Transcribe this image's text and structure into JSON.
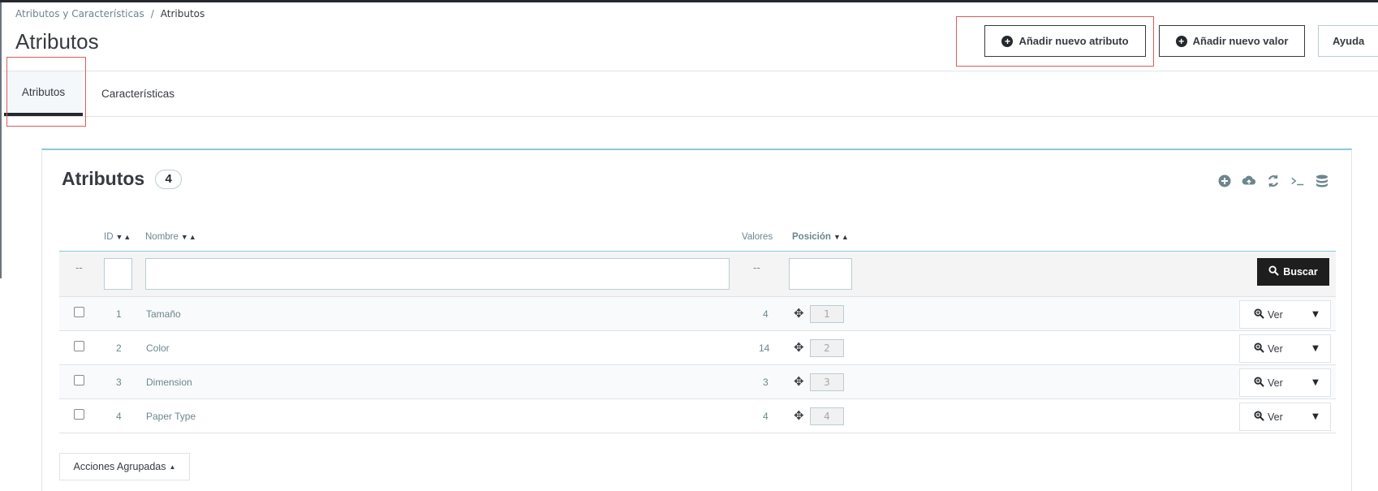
{
  "breadcrumb": {
    "parent": "Atributos y Características",
    "separator": "/",
    "current": "Atributos"
  },
  "page": {
    "title": "Atributos"
  },
  "toolbar": {
    "add_attribute": "Añadir nuevo atributo",
    "add_value": "Añadir nuevo valor",
    "help": "Ayuda"
  },
  "tabs": [
    {
      "label": "Atributos",
      "active": true
    },
    {
      "label": "Características",
      "active": false
    }
  ],
  "panel": {
    "title": "Atributos",
    "count": "4",
    "tool_icons": [
      "add-circle-icon",
      "cloud-upload-icon",
      "refresh-icon",
      "terminal-icon",
      "database-icon"
    ]
  },
  "table": {
    "headers": {
      "id": "ID",
      "name": "Nombre",
      "values": "Valores",
      "position": "Posición"
    },
    "filters": {
      "select_dash": "--",
      "values_dash": "--",
      "search_label": "Buscar"
    },
    "rows": [
      {
        "id": "1",
        "name": "Tamaño",
        "values": "4",
        "position": "1",
        "action": "Ver"
      },
      {
        "id": "2",
        "name": "Color",
        "values": "14",
        "position": "2",
        "action": "Ver"
      },
      {
        "id": "3",
        "name": "Dimension",
        "values": "3",
        "position": "3",
        "action": "Ver"
      },
      {
        "id": "4",
        "name": "Paper Type",
        "values": "4",
        "position": "4",
        "action": "Ver"
      }
    ]
  },
  "bulk_actions": {
    "label": "Acciones Agrupadas"
  },
  "colors": {
    "accent_border": "#8bc8d8",
    "highlight_red": "#e05b5b",
    "dark": "#25292d"
  }
}
